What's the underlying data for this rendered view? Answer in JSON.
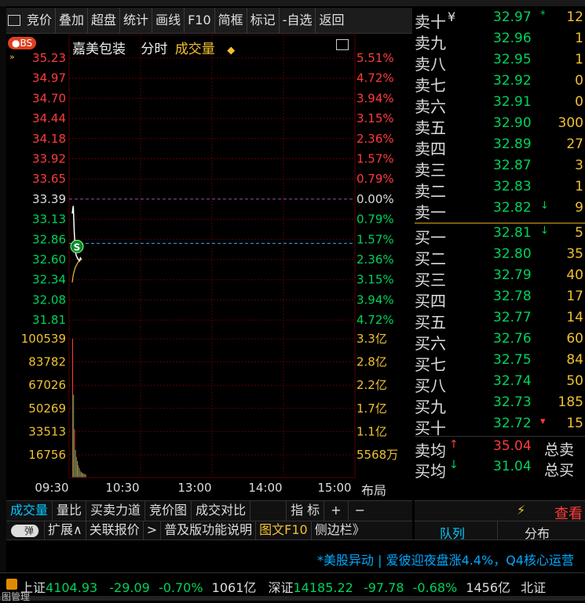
{
  "toolbar": {
    "items": [
      "竞价",
      "叠加",
      "超盘",
      "统计",
      "画线",
      "F10",
      "简框",
      "标记",
      "-自选",
      "返回"
    ]
  },
  "chart": {
    "bs_badge": "BS",
    "stock_name": "嘉美包装",
    "mode": "分时",
    "indicator": "成交量",
    "price_labels": [
      "35.23",
      "34.97",
      "34.70",
      "34.44",
      "34.18",
      "33.92",
      "33.65",
      "33.39",
      "33.13",
      "32.86",
      "32.60",
      "32.34",
      "32.08",
      "31.81"
    ],
    "pct_labels": [
      "5.51%",
      "4.72%",
      "3.94%",
      "3.15%",
      "2.36%",
      "1.57%",
      "0.79%",
      "0.00%",
      "0.79%",
      "1.57%",
      "2.36%",
      "3.15%",
      "3.94%",
      "4.72%"
    ],
    "vol_labels": [
      "100539",
      "83782",
      "67026",
      "50269",
      "33513",
      "16756"
    ],
    "amt_labels": [
      "3.3亿",
      "2.8亿",
      "2.2亿",
      "1.7亿",
      "1.1亿",
      "5568万"
    ],
    "time_labels": [
      "09:30",
      "10:30",
      "13:00",
      "14:00",
      "15:00"
    ],
    "layout_label": "布局",
    "s_marker": "S",
    "prev_close": 33.39,
    "current": 32.81,
    "colors": {
      "up": "#ff3b3b",
      "down": "#00d25a",
      "yellow": "#f0c030",
      "line": "#ffffff",
      "avg": "#f0c030",
      "grid": "#5a0000",
      "dash": "#3aa0ff",
      "prevclose": "#b040c0"
    },
    "price_series": [
      33.2,
      33.3,
      32.95,
      32.7,
      32.65,
      32.62,
      32.6,
      32.58,
      32.62,
      32.6
    ],
    "avg_series": [
      32.3,
      32.4,
      32.45,
      32.5,
      32.52,
      32.55,
      32.57,
      32.58,
      32.59,
      32.6
    ],
    "volume_series": [
      100539,
      60000,
      35000,
      20000,
      15000,
      12000,
      9000,
      7000,
      5000,
      4000,
      3500,
      3000,
      2800,
      2500,
      2200
    ]
  },
  "orderbook": {
    "asks": [
      {
        "label": "卖十",
        "sym": "¥",
        "price": "32.97",
        "flag": "*",
        "vol": "12"
      },
      {
        "label": "卖九",
        "price": "32.96",
        "vol": "1"
      },
      {
        "label": "卖八",
        "price": "32.95",
        "vol": "1"
      },
      {
        "label": "卖七",
        "price": "32.92",
        "vol": "0"
      },
      {
        "label": "卖六",
        "price": "32.91",
        "vol": "0"
      },
      {
        "label": "卖五",
        "price": "32.90",
        "vol": "300"
      },
      {
        "label": "卖四",
        "price": "32.89",
        "vol": "27"
      },
      {
        "label": "卖三",
        "price": "32.87",
        "vol": "3"
      },
      {
        "label": "卖二",
        "price": "32.83",
        "vol": "1"
      },
      {
        "label": "卖一",
        "price": "32.82",
        "flag": "↓",
        "vol": "9"
      }
    ],
    "bids": [
      {
        "label": "买一",
        "price": "32.81",
        "flag": "↓",
        "vol": "5"
      },
      {
        "label": "买二",
        "price": "32.80",
        "vol": "35"
      },
      {
        "label": "买三",
        "price": "32.79",
        "vol": "40"
      },
      {
        "label": "买四",
        "price": "32.78",
        "vol": "17"
      },
      {
        "label": "买五",
        "price": "32.77",
        "vol": "14"
      },
      {
        "label": "买六",
        "price": "32.76",
        "vol": "60"
      },
      {
        "label": "买七",
        "price": "32.75",
        "vol": "84"
      },
      {
        "label": "买八",
        "price": "32.74",
        "vol": "50"
      },
      {
        "label": "买九",
        "price": "32.73",
        "vol": "185"
      },
      {
        "label": "买十",
        "price": "32.72",
        "flag": "▾",
        "vol": "15"
      }
    ],
    "ask_avg": {
      "label": "卖均",
      "flag": "↑",
      "price": "35.04",
      "total_label": "总卖"
    },
    "bid_avg": {
      "label": "买均",
      "flag": "↓",
      "price": "31.04",
      "total_label": "总买"
    },
    "lightning": "⚡",
    "view_label": "查看"
  },
  "tabs1": [
    "成交量",
    "量比",
    "买卖力道",
    "竞价图",
    "成交对比",
    "指 标",
    "+",
    "−"
  ],
  "tabs2": {
    "toggle": "弹",
    "items": [
      "扩展∧",
      "关联报价",
      ">",
      "普及版功能说明",
      "图文F10",
      "侧边栏》"
    ]
  },
  "right_tabs": [
    "队列",
    "分布"
  ],
  "news": "*美股异动 | 爱彼迎夜盘涨4.4%，Q4核心运营",
  "status": {
    "sh_label": "上证",
    "sh_val": "4104.93",
    "sh_chg": "-29.09",
    "sh_pct": "-0.70%",
    "sh_amt": "1061亿",
    "sz_label": "深证",
    "sz_val": "14185.22",
    "sz_chg": "-97.78",
    "sz_pct": "-0.68%",
    "sz_amt": "1456亿",
    "bj_label": "北证"
  },
  "bottom_text": "图管理"
}
